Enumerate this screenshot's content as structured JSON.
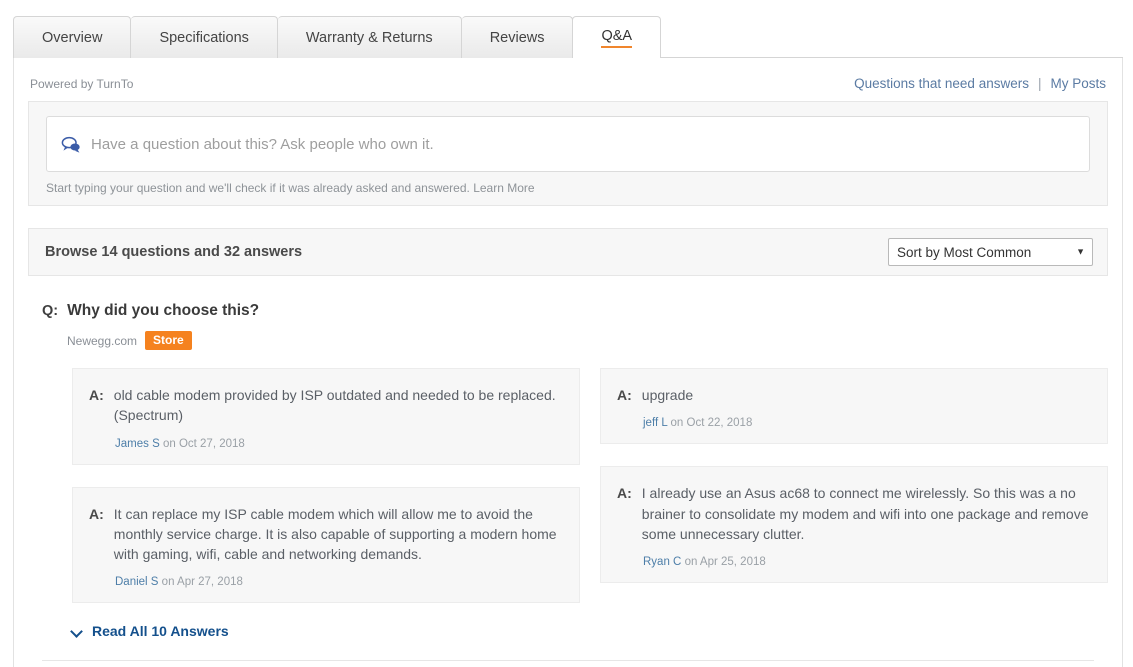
{
  "tabs": [
    {
      "label": "Overview",
      "active": false
    },
    {
      "label": "Specifications",
      "active": false
    },
    {
      "label": "Warranty & Returns",
      "active": false
    },
    {
      "label": "Reviews",
      "active": false
    },
    {
      "label": "Q&A",
      "active": true
    }
  ],
  "header": {
    "powered_by": "Powered by TurnTo",
    "need_answers_link": "Questions that need answers",
    "separator": "|",
    "my_posts_link": "My Posts"
  },
  "ask": {
    "icon": "speech-bubble-icon",
    "placeholder": "Have a question about this? Ask people who own it.",
    "value": "",
    "hint": "Start typing your question and we'll check if it was already asked and answered.",
    "hint_link": "Learn More"
  },
  "browse": {
    "title": "Browse 14 questions and 32 answers",
    "question_count": 14,
    "answer_count": 32,
    "sort_selected": "Sort by Most Common",
    "sort_options": [
      "Sort by Most Common"
    ],
    "sort_arrow": "▼"
  },
  "question": {
    "q_label": "Q:",
    "text": "Why did you choose this?",
    "source": "Newegg.com",
    "badge": "Store"
  },
  "answers": {
    "a_label": "A:",
    "left": [
      {
        "text": "old cable modem provided by ISP outdated and needed to be replaced. (Spectrum)",
        "author": "James S",
        "date": "on Oct 27, 2018"
      },
      {
        "text": "It can replace my ISP cable modem which will allow me to avoid the monthly service charge. It is also capable of supporting a modern home with gaming, wifi, cable and networking demands.",
        "author": "Daniel S",
        "date": "on Apr 27, 2018"
      }
    ],
    "right": [
      {
        "text": "upgrade",
        "author": "jeff L",
        "date": "on Oct 22, 2018"
      },
      {
        "text": "I already use an Asus ac68 to connect me wirelessly. So this was a no brainer to consolidate my modem and wifi into one package and remove some unnecessary clutter.",
        "author": "Ryan C",
        "date": "on Apr 25, 2018"
      }
    ]
  },
  "read_all": {
    "label": "Read All 10 Answers",
    "icon": "chevron-down-icon",
    "count": 10
  },
  "colors": {
    "accent_orange": "#f5821f",
    "link_blue": "#14508c",
    "author_blue": "#4d7ea8",
    "header_link": "#5b7ba3",
    "panel_gray": "#f7f7f7"
  }
}
